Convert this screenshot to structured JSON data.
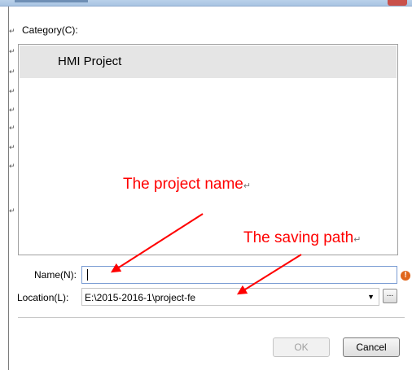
{
  "dialog": {
    "category_label": "Category(C):",
    "categories": [
      "HMI Project"
    ],
    "name_label": "Name(N):",
    "name_value": "",
    "warning_icon": "exclamation-icon",
    "location_label": "Location(L):",
    "location_value": "E:\\2015-2016-1\\project-fe",
    "browse_label": "...",
    "ok_label": "OK",
    "cancel_label": "Cancel"
  },
  "annotations": {
    "project_name": "The project name",
    "saving_path": "The saving path",
    "color": "#ff0000"
  },
  "para_mark": "↵"
}
